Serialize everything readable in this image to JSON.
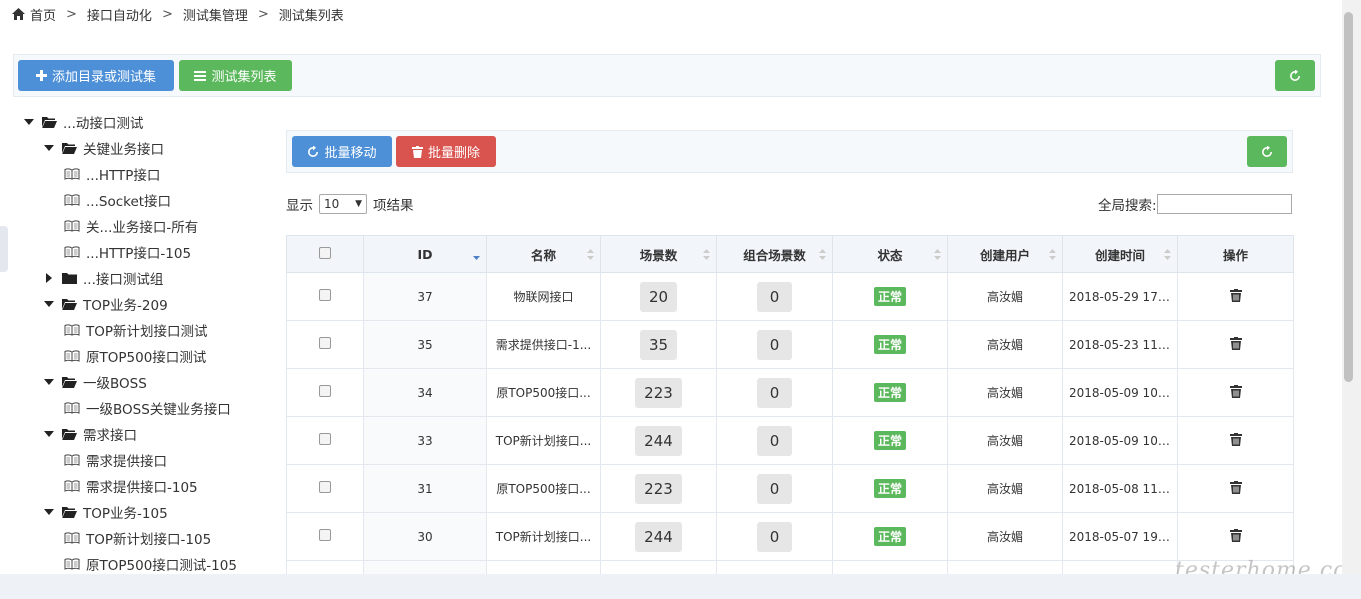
{
  "breadcrumb": {
    "items": [
      "首页",
      "接口自动化",
      "测试集管理",
      "测试集列表"
    ],
    "separator": ">"
  },
  "toolbar": {
    "add_label": "添加目录或测试集",
    "list_label": "测试集列表"
  },
  "tree": {
    "nodes": [
      {
        "label": "...动接口测试",
        "level": 0,
        "kind": "folder",
        "expanded": true
      },
      {
        "label": "关键业务接口",
        "level": 1,
        "kind": "folder",
        "expanded": true
      },
      {
        "label": "...HTTP接口",
        "level": 2,
        "kind": "leaf"
      },
      {
        "label": "...Socket接口",
        "level": 2,
        "kind": "leaf"
      },
      {
        "label": "关...业务接口-所有",
        "level": 2,
        "kind": "leaf"
      },
      {
        "label": "...HTTP接口-105",
        "level": 2,
        "kind": "leaf"
      },
      {
        "label": "...接口测试组",
        "level": 1,
        "kind": "folder",
        "expanded": false
      },
      {
        "label": "TOP业务-209",
        "level": 1,
        "kind": "folder",
        "expanded": true
      },
      {
        "label": "TOP新计划接口测试",
        "level": 2,
        "kind": "leaf"
      },
      {
        "label": "原TOP500接口测试",
        "level": 2,
        "kind": "leaf"
      },
      {
        "label": "一级BOSS",
        "level": 1,
        "kind": "folder",
        "expanded": true
      },
      {
        "label": "一级BOSS关键业务接口",
        "level": 2,
        "kind": "leaf"
      },
      {
        "label": "需求接口",
        "level": 1,
        "kind": "folder",
        "expanded": true
      },
      {
        "label": "需求提供接口",
        "level": 2,
        "kind": "leaf"
      },
      {
        "label": "需求提供接口-105",
        "level": 2,
        "kind": "leaf"
      },
      {
        "label": "TOP业务-105",
        "level": 1,
        "kind": "folder",
        "expanded": true
      },
      {
        "label": "TOP新计划接口-105",
        "level": 2,
        "kind": "leaf"
      },
      {
        "label": "原TOP500接口测试-105",
        "level": 2,
        "kind": "leaf"
      }
    ]
  },
  "panel": {
    "move_label": "批量移动",
    "delete_label": "批量删除"
  },
  "length": {
    "prefix": "显示",
    "value": "10",
    "suffix": "项结果"
  },
  "search": {
    "label": "全局搜索:",
    "value": ""
  },
  "table": {
    "headers": [
      "ID",
      "名称",
      "场景数",
      "组合场景数",
      "状态",
      "创建用户",
      "创建时间",
      "操作"
    ],
    "rows": [
      {
        "id": "37",
        "name": "物联网接口",
        "scenes": "20",
        "combo": "0",
        "status": "正常",
        "user": "高汝媚",
        "time": "2018-05-29 17:..."
      },
      {
        "id": "35",
        "name": "需求提供接口-1...",
        "scenes": "35",
        "combo": "0",
        "status": "正常",
        "user": "高汝媚",
        "time": "2018-05-23 11:..."
      },
      {
        "id": "34",
        "name": "原TOP500接口...",
        "scenes": "223",
        "combo": "0",
        "status": "正常",
        "user": "高汝媚",
        "time": "2018-05-09 10:..."
      },
      {
        "id": "33",
        "name": "TOP新计划接口...",
        "scenes": "244",
        "combo": "0",
        "status": "正常",
        "user": "高汝媚",
        "time": "2018-05-09 10:..."
      },
      {
        "id": "31",
        "name": "原TOP500接口...",
        "scenes": "223",
        "combo": "0",
        "status": "正常",
        "user": "高汝媚",
        "time": "2018-05-08 11:..."
      },
      {
        "id": "30",
        "name": "TOP新计划接口...",
        "scenes": "244",
        "combo": "0",
        "status": "正常",
        "user": "高汝媚",
        "time": "2018-05-07 19:..."
      }
    ]
  },
  "watermark": "testerhome.com",
  "colors": {
    "primary": "#4e90d8",
    "success": "#5cb85c",
    "danger": "#d9534f"
  }
}
